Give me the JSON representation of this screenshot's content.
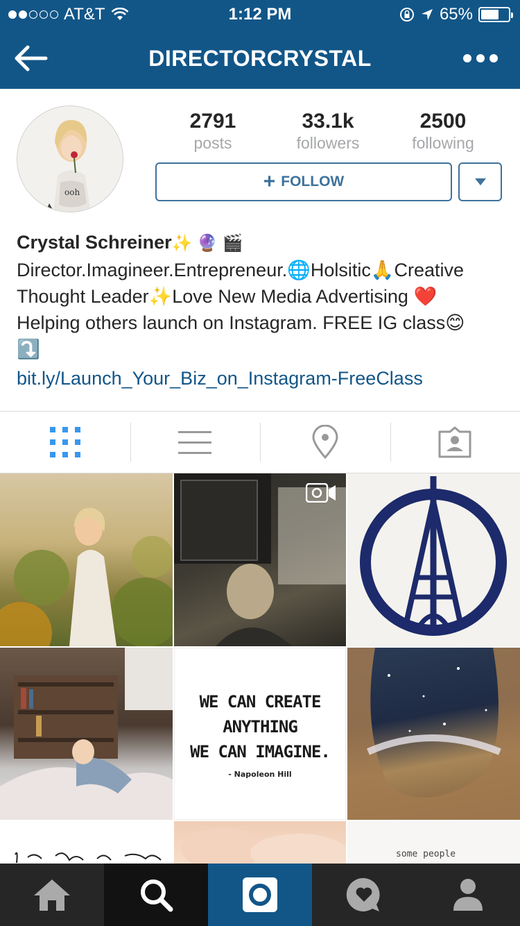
{
  "status_bar": {
    "carrier": "AT&T",
    "time": "1:12 PM",
    "battery": "65%",
    "battery_level": 0.65,
    "signal_bars_filled": 2,
    "signal_bars_total": 5,
    "icons": [
      "signal-dots-icon",
      "wifi-icon",
      "rotation-lock-icon",
      "location-arrow-icon",
      "battery-icon"
    ]
  },
  "nav": {
    "title": "DIRECTORCRYSTAL",
    "back_icon": "back-arrow-icon",
    "more_icon": "more-dots-icon"
  },
  "profile": {
    "stats": [
      {
        "value": "2791",
        "label": "posts"
      },
      {
        "value": "33.1k",
        "label": "followers"
      },
      {
        "value": "2500",
        "label": "following"
      }
    ],
    "follow_label": "FOLLOW",
    "name": "Crystal Schreiner",
    "name_emojis": "✨ 🔮 🎬",
    "bio_line1": "Director.Imagineer.Entrepreneur.🌐Holsitic🙏Creative",
    "bio_line2": "Thought Leader✨Love New Media Advertising ❤️",
    "bio_line3": "Helping others launch on Instagram. FREE IG class😊",
    "bio_line4": "⤵️",
    "link": "bit.ly/Launch_Your_Biz_on_Instagram-FreeClass"
  },
  "tabs": [
    {
      "name": "grid",
      "icon": "grid-icon",
      "active": true
    },
    {
      "name": "list",
      "icon": "list-icon",
      "active": false
    },
    {
      "name": "map",
      "icon": "location-pin-icon",
      "active": false
    },
    {
      "name": "tagged",
      "icon": "tagged-person-icon",
      "active": false
    }
  ],
  "photos": {
    "quote_line1": "WE CAN CREATE",
    "quote_line2": "ANYTHING",
    "quote_line3": "WE CAN IMAGINE.",
    "quote_author": "- Napoleon Hill",
    "partial_text_left": "..li..tr..vs..l..com",
    "partial_text_right": "some people"
  },
  "bottom_nav": [
    {
      "name": "home",
      "icon": "home-icon"
    },
    {
      "name": "explore",
      "icon": "search-icon"
    },
    {
      "name": "camera",
      "icon": "camera-icon",
      "active": true
    },
    {
      "name": "activity",
      "icon": "heart-bubble-icon"
    },
    {
      "name": "profile",
      "icon": "profile-icon"
    }
  ],
  "colors": {
    "brand_blue": "#125688",
    "follow_blue": "#3f729b",
    "active_tab_blue": "#3897f0",
    "bottom_bar": "#262626"
  }
}
